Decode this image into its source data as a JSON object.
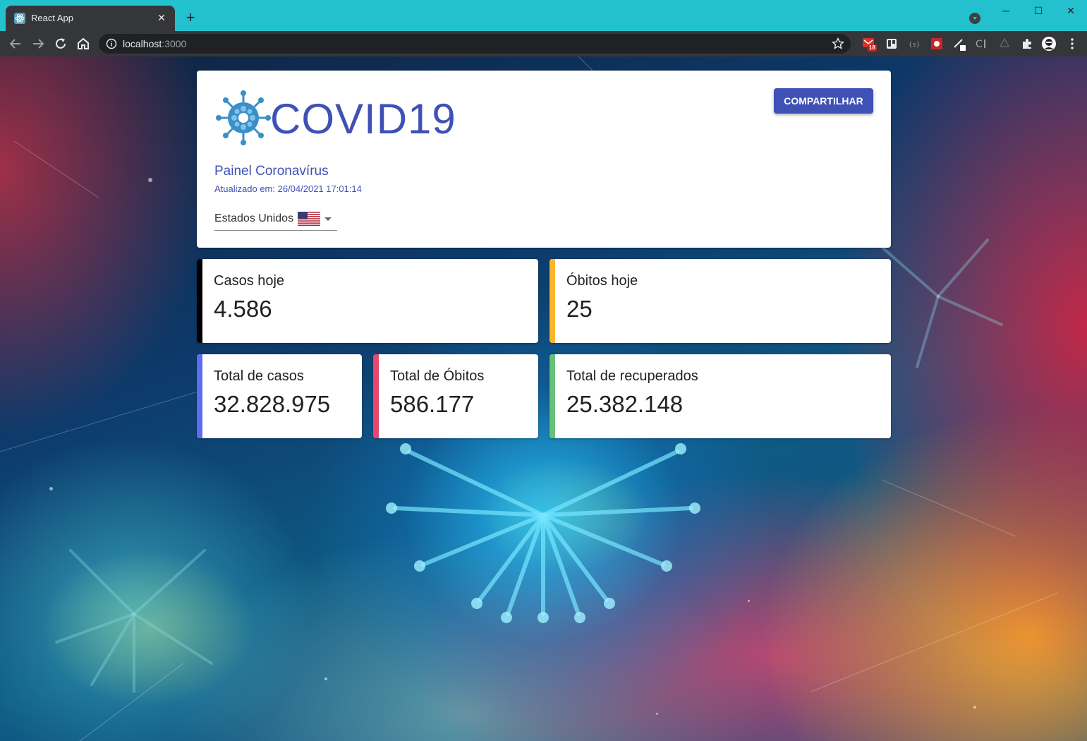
{
  "browser": {
    "tab_title": "React App",
    "url_host": "localhost",
    "url_port": ":3000",
    "gmail_badge": "18"
  },
  "header": {
    "logo_text": "COVID19",
    "share_button": "COMPARTILHAR",
    "panel_title": "Painel Coronavírus",
    "updated_label": "Atualizado em: 26/04/2021 17:01:14",
    "country": "Estados Unidos"
  },
  "stats": {
    "cases_today": {
      "label": "Casos hoje",
      "value": "4.586",
      "color": "#000000"
    },
    "deaths_today": {
      "label": "Óbitos hoje",
      "value": "25",
      "color": "#f9b42d"
    },
    "total_cases": {
      "label": "Total de casos",
      "value": "32.828.975",
      "color": "#5d6cf5"
    },
    "total_deaths": {
      "label": "Total de Óbitos",
      "value": "586.177",
      "color": "#e8466f"
    },
    "total_recovered": {
      "label": "Total de recuperados",
      "value": "25.382.148",
      "color": "#67c17a"
    }
  },
  "colors": {
    "primary": "#3f51b5",
    "titlebar": "#22c1cd",
    "toolbar": "#35363a"
  }
}
